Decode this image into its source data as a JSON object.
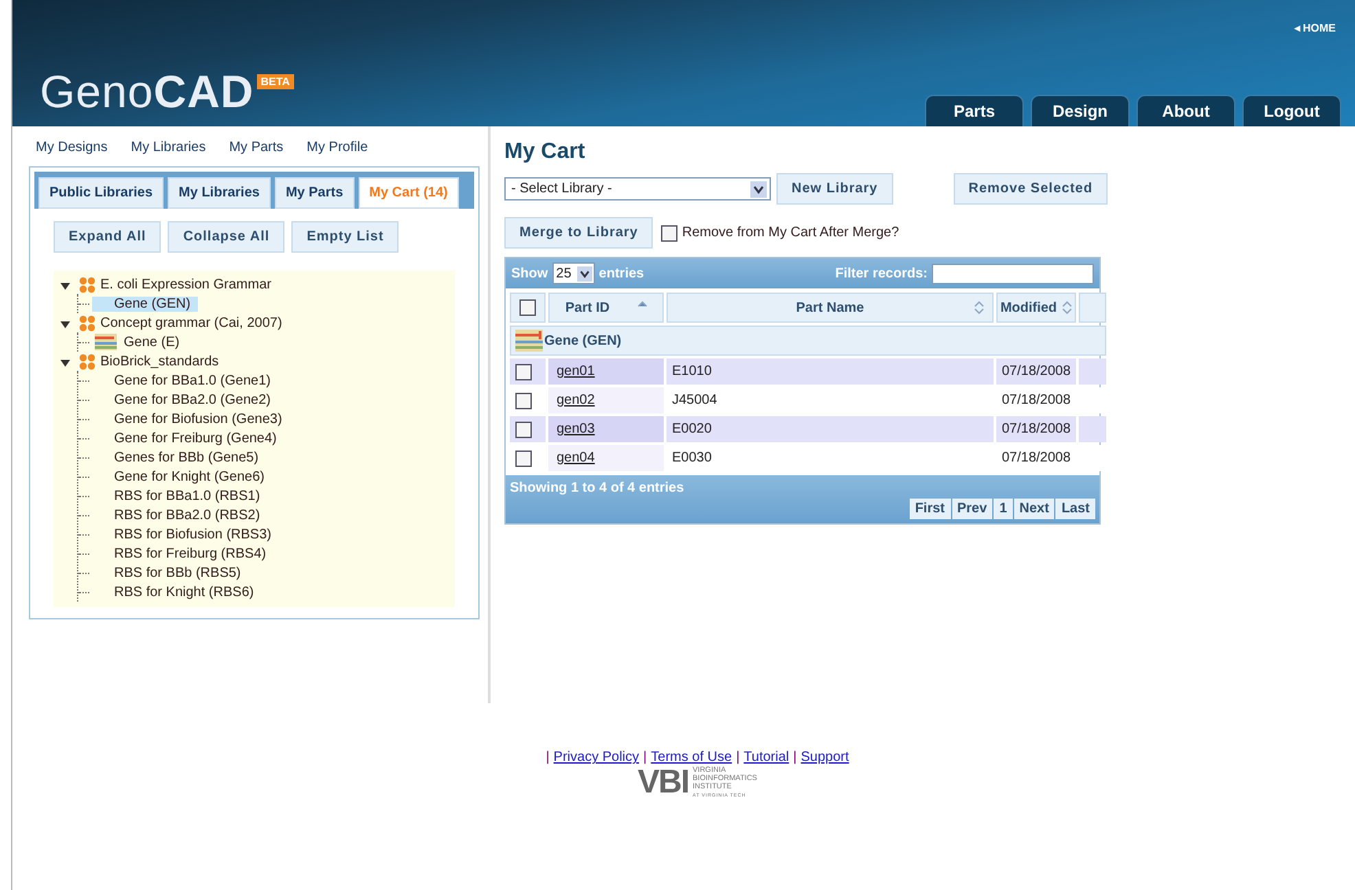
{
  "header": {
    "home_link": "◂ HOME",
    "logo": {
      "first": "Geno",
      "second": "CAD",
      "badge": "BETA"
    },
    "nav_tabs": [
      {
        "label": "Parts"
      },
      {
        "label": "Design"
      },
      {
        "label": "About"
      },
      {
        "label": "Logout"
      }
    ]
  },
  "subnav": [
    "My Designs",
    "My Libraries",
    "My Parts",
    "My Profile"
  ],
  "library_tabs": [
    {
      "label": "Public Libraries",
      "selected": false
    },
    {
      "label": "My Libraries",
      "selected": false
    },
    {
      "label": "My Parts",
      "selected": false
    },
    {
      "label": "My Cart (14)",
      "selected": true
    }
  ],
  "tree_buttons": [
    "Expand All",
    "Collapse All",
    "Empty List"
  ],
  "tree": [
    {
      "label": "E. coli Expression Grammar",
      "expanded": true,
      "children": [
        {
          "label": "Gene (GEN)",
          "selected": true,
          "icon": false
        }
      ]
    },
    {
      "label": "Concept grammar (Cai, 2007)",
      "expanded": true,
      "children": [
        {
          "label": "Gene (E)",
          "selected": false,
          "icon": true
        }
      ]
    },
    {
      "label": "BioBrick_standards",
      "expanded": true,
      "children": [
        {
          "label": "Gene for BBa1.0 (Gene1)",
          "selected": false,
          "icon": false
        },
        {
          "label": "Gene for BBa2.0 (Gene2)",
          "selected": false,
          "icon": false
        },
        {
          "label": "Gene for Biofusion (Gene3)",
          "selected": false,
          "icon": false
        },
        {
          "label": "Gene for Freiburg (Gene4)",
          "selected": false,
          "icon": false
        },
        {
          "label": "Genes for BBb (Gene5)",
          "selected": false,
          "icon": false
        },
        {
          "label": "Gene for Knight (Gene6)",
          "selected": false,
          "icon": false
        },
        {
          "label": "RBS for BBa1.0 (RBS1)",
          "selected": false,
          "icon": false
        },
        {
          "label": "RBS for BBa2.0 (RBS2)",
          "selected": false,
          "icon": false
        },
        {
          "label": "RBS for Biofusion (RBS3)",
          "selected": false,
          "icon": false
        },
        {
          "label": "RBS for Freiburg (RBS4)",
          "selected": false,
          "icon": false
        },
        {
          "label": "RBS for BBb (RBS5)",
          "selected": false,
          "icon": false
        },
        {
          "label": "RBS for Knight (RBS6)",
          "selected": false,
          "icon": false
        }
      ]
    }
  ],
  "cart": {
    "title": "My Cart",
    "library_select": "- Select Library -",
    "new_library": "New Library",
    "remove_selected": "Remove Selected",
    "merge": "Merge to Library",
    "remove_after_merge": {
      "label": "Remove from My Cart After Merge?",
      "checked": false
    },
    "table": {
      "show": "Show",
      "page_size": "25",
      "entries": "entries",
      "filter_label": "Filter records:",
      "header_checked": false,
      "columns": [
        {
          "label": "Part ID",
          "sorted_ascending": true
        },
        {
          "label": "Part Name",
          "sorted_ascending": false
        },
        {
          "label": "Modified",
          "sorted_ascending": false
        }
      ],
      "group": "Gene (GEN)",
      "rows": [
        {
          "id": "gen01",
          "name": "E1010",
          "modified": "07/18/2008",
          "checked": false
        },
        {
          "id": "gen02",
          "name": "J45004",
          "modified": "07/18/2008",
          "checked": false
        },
        {
          "id": "gen03",
          "name": "E0020",
          "modified": "07/18/2008",
          "checked": false
        },
        {
          "id": "gen04",
          "name": "E0030",
          "modified": "07/18/2008",
          "checked": false
        }
      ],
      "info": "Showing 1 to 4 of 4 entries",
      "pager": [
        "First",
        "Prev",
        "1",
        "Next",
        "Last"
      ]
    }
  },
  "footer": {
    "separator": "|",
    "links": [
      "Privacy Policy",
      "Terms of Use",
      "Tutorial",
      "Support"
    ],
    "vbi": {
      "mark": "VBI",
      "lines": [
        "VIRGINIA",
        "BIOINFORMATICS",
        "INSTITUTE",
        "AT VIRGINIA TECH"
      ]
    }
  }
}
